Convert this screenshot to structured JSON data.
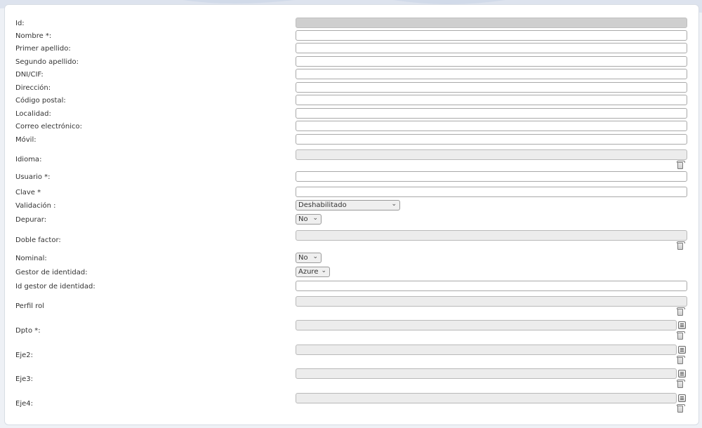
{
  "form": {
    "fields": [
      {
        "key": "id",
        "label": "Id:",
        "type": "text",
        "value": "",
        "readonly": true
      },
      {
        "key": "nombre",
        "label": "Nombre *:",
        "type": "text",
        "value": ""
      },
      {
        "key": "primer_apellido",
        "label": "Primer apellido:",
        "type": "text",
        "value": ""
      },
      {
        "key": "segundo_apellido",
        "label": "Segundo apellido:",
        "type": "text",
        "value": ""
      },
      {
        "key": "dni_cif",
        "label": "DNI/CIF:",
        "type": "text",
        "value": ""
      },
      {
        "key": "direccion",
        "label": "Dirección:",
        "type": "text",
        "value": ""
      },
      {
        "key": "codigo_postal",
        "label": "Código postal:",
        "type": "text",
        "value": ""
      },
      {
        "key": "localidad",
        "label": "Localidad:",
        "type": "text",
        "value": ""
      },
      {
        "key": "correo",
        "label": "Correo electrónico:",
        "type": "text",
        "value": ""
      },
      {
        "key": "movil",
        "label": "Móvil:",
        "type": "text",
        "value": ""
      },
      {
        "key": "idioma",
        "label": "Idioma:",
        "type": "lookup",
        "value": "",
        "icons": [
          "trash-icon"
        ]
      },
      {
        "key": "usuario",
        "label": "Usuario *:",
        "type": "text",
        "value": ""
      },
      {
        "key": "clave",
        "label": "Clave *",
        "type": "text",
        "value": ""
      },
      {
        "key": "validacion",
        "label": "Validación :",
        "type": "select",
        "selected": "Deshabilitado"
      },
      {
        "key": "depurar",
        "label": "Depurar:",
        "type": "select",
        "selected": "No"
      },
      {
        "key": "doble_factor",
        "label": "Doble factor:",
        "type": "lookup",
        "value": "",
        "icons": [
          "trash-icon"
        ]
      },
      {
        "key": "nominal",
        "label": "Nominal:",
        "type": "select",
        "selected": "No"
      },
      {
        "key": "gestor_identidad",
        "label": "Gestor de identidad:",
        "type": "select",
        "selected": "Azure"
      },
      {
        "key": "id_gestor_identidad",
        "label": "Id gestor de identidad:",
        "type": "text",
        "value": ""
      },
      {
        "key": "perfil_rol",
        "label": "Perfil rol",
        "type": "lookup",
        "value": "",
        "icons": [
          "trash-icon"
        ]
      },
      {
        "key": "dpto",
        "label": "Dpto *:",
        "type": "lookup",
        "value": "",
        "icons": [
          "list-icon",
          "trash-icon"
        ]
      },
      {
        "key": "eje2",
        "label": "Eje2:",
        "type": "lookup",
        "value": "",
        "icons": [
          "list-icon",
          "trash-icon"
        ]
      },
      {
        "key": "eje3",
        "label": "Eje3:",
        "type": "lookup",
        "value": "",
        "icons": [
          "list-icon",
          "trash-icon"
        ]
      },
      {
        "key": "eje4",
        "label": "Eje4:",
        "type": "lookup",
        "value": "",
        "icons": [
          "list-icon",
          "trash-icon"
        ]
      }
    ]
  }
}
